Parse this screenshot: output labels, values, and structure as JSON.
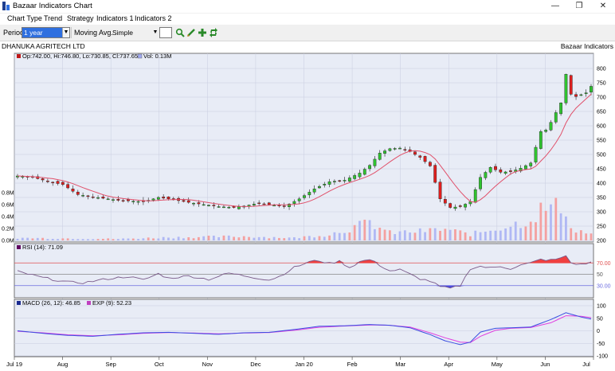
{
  "window": {
    "title": "Bazaar Indicators Chart",
    "min": "—",
    "max": "❐",
    "close": "✕"
  },
  "menu": [
    "Chart Type",
    "Trend",
    "Strategy",
    "Indicators 1",
    "Indicators 2"
  ],
  "toolbar": {
    "period_label": "Period",
    "period_value": "1 year",
    "ma_label": "Moving Avg.",
    "ma_value": "Simple",
    "icons": [
      "search-icon",
      "pen-icon",
      "plus-icon",
      "refresh-icon"
    ]
  },
  "info": {
    "company": "DHANUKA AGRITECH LTD",
    "brand": "Bazaar Indicators"
  },
  "colors": {
    "bg": "#e8ecf6",
    "up": "#2fc42f",
    "down": "#e01e1e",
    "ma": "#e0506a",
    "rsi": "#7a5a8a",
    "macd": "#3a4ee0",
    "exp": "#e040e0",
    "grid": "#c8cde0"
  },
  "chart_data": [
    {
      "type": "candlestick",
      "legend": {
        "ohlc": "Op:742.00, Hi:746.80, Lo:730.85, Cl:737.65",
        "vol": "Vol: 0.13M"
      },
      "yticks": [
        "800",
        "750",
        "700",
        "650",
        "600",
        "550",
        "500",
        "450",
        "400",
        "350",
        "300",
        "250",
        "200"
      ],
      "ylim": [
        200,
        800
      ],
      "vol_ticks": [
        "0.8M",
        "0.6M",
        "0.4M",
        "0.2M",
        "0.0M"
      ],
      "vol_lim": [
        0,
        0.8
      ],
      "x_labels": [
        "Jul 19",
        "Aug",
        "Sep",
        "Oct",
        "Nov",
        "Dec",
        "Jan 20",
        "Feb",
        "Mar",
        "Apr",
        "May",
        "Jun",
        "Jul"
      ],
      "close_keypoints": [
        [
          0,
          425
        ],
        [
          3,
          420
        ],
        [
          7,
          402
        ],
        [
          9,
          395
        ],
        [
          12,
          360
        ],
        [
          15,
          352
        ],
        [
          20,
          340
        ],
        [
          25,
          335
        ],
        [
          28,
          350
        ],
        [
          30,
          345
        ],
        [
          35,
          330
        ],
        [
          40,
          318
        ],
        [
          43,
          315
        ],
        [
          45,
          320
        ],
        [
          48,
          330
        ],
        [
          50,
          325
        ],
        [
          53,
          318
        ],
        [
          56,
          345
        ],
        [
          59,
          380
        ],
        [
          62,
          405
        ],
        [
          65,
          410
        ],
        [
          68,
          435
        ],
        [
          70,
          462
        ],
        [
          72,
          505
        ],
        [
          74,
          520
        ],
        [
          76,
          522
        ],
        [
          78,
          510
        ],
        [
          80,
          490
        ],
        [
          82,
          460
        ],
        [
          84,
          345
        ],
        [
          86,
          315
        ],
        [
          88,
          318
        ],
        [
          90,
          335
        ],
        [
          92,
          420
        ],
        [
          94,
          455
        ],
        [
          96,
          438
        ],
        [
          98,
          440
        ],
        [
          100,
          452
        ],
        [
          102,
          470
        ],
        [
          104,
          580
        ],
        [
          105,
          585
        ],
        [
          106,
          612
        ],
        [
          108,
          680
        ],
        [
          109,
          780
        ],
        [
          110,
          710
        ],
        [
          111,
          702
        ],
        [
          113,
          715
        ],
        [
          114,
          737.65
        ]
      ],
      "volume_spikes": [
        [
          0,
          0.05
        ],
        [
          10,
          0.04
        ],
        [
          20,
          0.03
        ],
        [
          30,
          0.06
        ],
        [
          45,
          0.08
        ],
        [
          55,
          0.05
        ],
        [
          62,
          0.12
        ],
        [
          70,
          0.35
        ],
        [
          74,
          0.15
        ],
        [
          80,
          0.18
        ],
        [
          85,
          0.22
        ],
        [
          90,
          0.12
        ],
        [
          100,
          0.35
        ],
        [
          102,
          0.42
        ],
        [
          104,
          0.6
        ],
        [
          106,
          0.65
        ],
        [
          108,
          0.65
        ],
        [
          109,
          0.68
        ],
        [
          110,
          0.22
        ],
        [
          114,
          0.13
        ]
      ]
    },
    {
      "type": "line",
      "legend": "RSI (14): 71.09",
      "yticks": [
        "70.00",
        "50",
        "30.00"
      ],
      "ylim": [
        10,
        90
      ],
      "levels": [
        70,
        50,
        30
      ],
      "keypoints": [
        [
          0,
          55
        ],
        [
          5,
          44
        ],
        [
          10,
          36
        ],
        [
          13,
          35
        ],
        [
          18,
          42
        ],
        [
          22,
          46
        ],
        [
          25,
          40
        ],
        [
          28,
          51
        ],
        [
          30,
          43
        ],
        [
          34,
          47
        ],
        [
          38,
          41
        ],
        [
          42,
          52
        ],
        [
          46,
          46
        ],
        [
          50,
          40
        ],
        [
          52,
          46
        ],
        [
          55,
          62
        ],
        [
          58,
          72
        ],
        [
          60,
          74
        ],
        [
          62,
          69
        ],
        [
          64,
          73
        ],
        [
          66,
          62
        ],
        [
          68,
          72
        ],
        [
          70,
          76
        ],
        [
          72,
          66
        ],
        [
          74,
          56
        ],
        [
          76,
          58
        ],
        [
          78,
          50
        ],
        [
          80,
          42
        ],
        [
          82,
          38
        ],
        [
          84,
          28
        ],
        [
          86,
          25
        ],
        [
          88,
          30
        ],
        [
          90,
          60
        ],
        [
          92,
          64
        ],
        [
          94,
          61
        ],
        [
          96,
          64
        ],
        [
          98,
          60
        ],
        [
          100,
          66
        ],
        [
          102,
          70
        ],
        [
          104,
          76
        ],
        [
          106,
          75
        ],
        [
          108,
          78
        ],
        [
          109,
          83
        ],
        [
          110,
          70
        ],
        [
          112,
          67
        ],
        [
          114,
          71.09
        ]
      ]
    },
    {
      "type": "line",
      "legend": {
        "macd": "MACD (26, 12): 46.85",
        "exp": "EXP (9): 52.23"
      },
      "yticks": [
        "100",
        "50",
        "0",
        "-50",
        "-100"
      ],
      "ylim": [
        -100,
        100
      ],
      "macd_keypoints": [
        [
          0,
          0
        ],
        [
          5,
          -10
        ],
        [
          10,
          -18
        ],
        [
          15,
          -22
        ],
        [
          20,
          -14
        ],
        [
          25,
          -8
        ],
        [
          30,
          -6
        ],
        [
          35,
          -10
        ],
        [
          40,
          -14
        ],
        [
          45,
          -8
        ],
        [
          50,
          -6
        ],
        [
          55,
          5
        ],
        [
          60,
          18
        ],
        [
          65,
          20
        ],
        [
          70,
          25
        ],
        [
          74,
          22
        ],
        [
          78,
          12
        ],
        [
          82,
          -15
        ],
        [
          85,
          -40
        ],
        [
          88,
          -55
        ],
        [
          90,
          -45
        ],
        [
          92,
          -5
        ],
        [
          95,
          10
        ],
        [
          98,
          12
        ],
        [
          102,
          15
        ],
        [
          106,
          45
        ],
        [
          109,
          72
        ],
        [
          112,
          55
        ],
        [
          114,
          46.85
        ]
      ],
      "exp_keypoints": [
        [
          0,
          -2
        ],
        [
          5,
          -8
        ],
        [
          10,
          -16
        ],
        [
          15,
          -20
        ],
        [
          20,
          -16
        ],
        [
          25,
          -10
        ],
        [
          30,
          -7
        ],
        [
          35,
          -9
        ],
        [
          40,
          -12
        ],
        [
          45,
          -9
        ],
        [
          50,
          -7
        ],
        [
          55,
          2
        ],
        [
          60,
          14
        ],
        [
          65,
          19
        ],
        [
          70,
          23
        ],
        [
          74,
          22
        ],
        [
          78,
          15
        ],
        [
          82,
          -8
        ],
        [
          85,
          -28
        ],
        [
          88,
          -45
        ],
        [
          90,
          -47
        ],
        [
          92,
          -22
        ],
        [
          95,
          2
        ],
        [
          98,
          10
        ],
        [
          102,
          13
        ],
        [
          106,
          32
        ],
        [
          109,
          60
        ],
        [
          112,
          58
        ],
        [
          114,
          52.23
        ]
      ]
    }
  ]
}
